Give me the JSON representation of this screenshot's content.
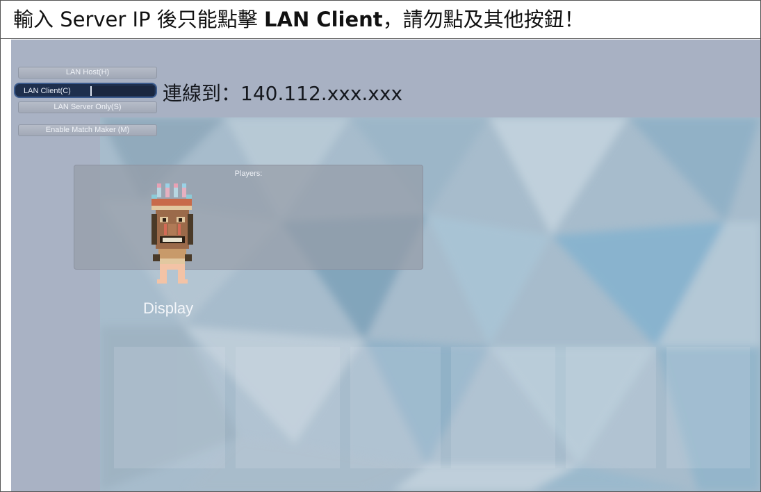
{
  "banner": {
    "prefix": "輸入 Server IP 後只能點擊 ",
    "emphasis": "LAN Client",
    "suffix": "，請勿點及其他按鈕！"
  },
  "menu": {
    "lan_host": "LAN Host(H)",
    "lan_client": "LAN Client(C)",
    "lan_server_only": "LAN Server Only(S)",
    "match_maker": "Enable Match Maker (M)"
  },
  "client_ip_value": "",
  "connection_note": "連線到：140.112.xxx.xxx",
  "lobby": {
    "players_title": "Players:"
  },
  "player": {
    "name": "Display"
  },
  "colors": {
    "game_bg": "#a8b1c3",
    "client_button": "#1e2f4d",
    "client_border": "#3b5b8e"
  }
}
